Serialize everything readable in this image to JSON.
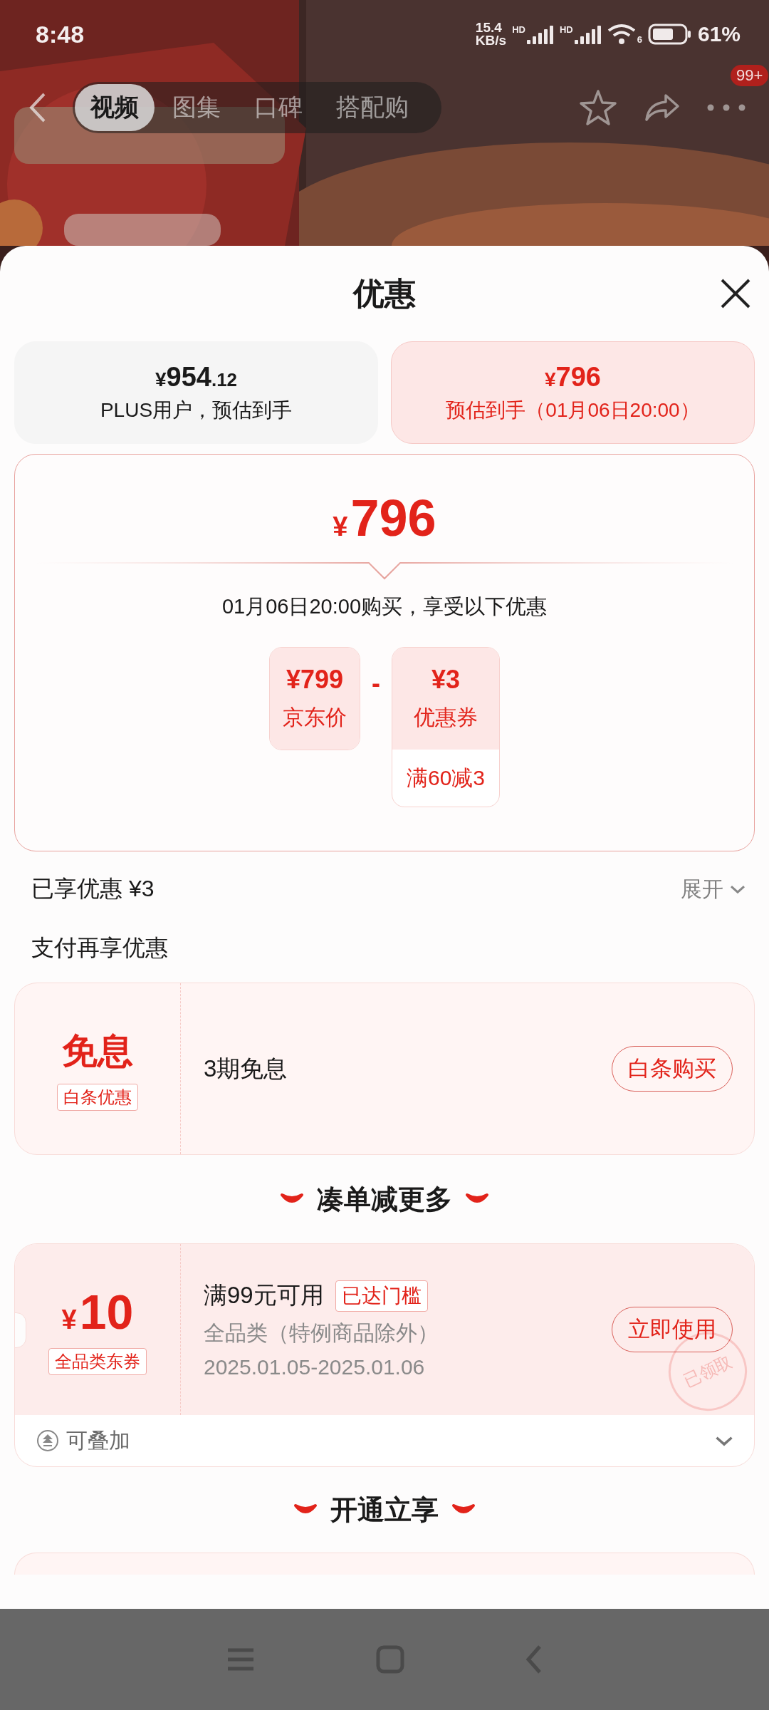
{
  "status_bar": {
    "time": "8:48",
    "net_speed": "15.4",
    "net_unit": "KB/s",
    "sim_1": "HD",
    "sim_2": "HD",
    "wifi_badge": "6",
    "battery": "61%"
  },
  "product_header": {
    "tabs": [
      {
        "label": "视频",
        "selected": true
      },
      {
        "label": "图集",
        "selected": false
      },
      {
        "label": "口碑",
        "selected": false
      },
      {
        "label": "搭配购",
        "selected": false
      }
    ],
    "more_badge": "99+"
  },
  "sheet": {
    "title": "优惠",
    "price_options": [
      {
        "currency": "¥",
        "amount": "954",
        "decimals": ".12",
        "caption": "PLUS用户，预估到手",
        "selected": false
      },
      {
        "currency": "¥",
        "amount": "796",
        "caption": "预估到手（01月06日20:00）",
        "selected": true
      }
    ],
    "estimate": {
      "currency": "¥",
      "amount": "796",
      "note": "01月06日20:00购买，享受以下优惠",
      "operator": "-",
      "items": [
        {
          "kind": "price",
          "amount": "¥799",
          "label": "京东价"
        },
        {
          "kind": "coupon",
          "amount": "¥3",
          "label": "优惠券",
          "condition": "满60减3"
        }
      ]
    },
    "saved": {
      "text": "已享优惠 ¥3",
      "toggle": "展开"
    },
    "payment_heading": "支付再享优惠",
    "payment_offer": {
      "title": "免息",
      "tag": "白条优惠",
      "description": "3期免息",
      "button": "白条购买"
    },
    "more_deals": {
      "heading": "凑单减更多",
      "coupons": [
        {
          "currency": "¥",
          "amount": "10",
          "tag": "全品类东券",
          "condition": "满99元可用",
          "badge": "已达门槛",
          "scope": "全品类（特例商品除外）",
          "validity": "2025.01.05-2025.01.06",
          "button": "立即使用",
          "stamp": "已领取",
          "stackable": "可叠加"
        }
      ]
    },
    "membership": {
      "heading": "开通立享"
    }
  }
}
